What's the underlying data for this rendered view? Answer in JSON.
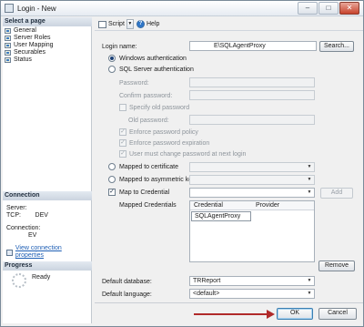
{
  "window": {
    "title": "Login - New"
  },
  "left": {
    "select_page_header": "Select a page",
    "pages": [
      "General",
      "Server Roles",
      "User Mapping",
      "Securables",
      "Status"
    ],
    "connection_header": "Connection",
    "server_label": "Server:",
    "server_value": "",
    "server_tcp": "TCP:",
    "server_tcp_value": "DEV",
    "connection_label": "Connection:",
    "connection_value": "EV",
    "view_connection_link": "View connection properties",
    "progress_header": "Progress",
    "progress_status": "Ready"
  },
  "toolbar": {
    "script_label": "Script",
    "help_label": "Help"
  },
  "form": {
    "login_name_label": "Login name:",
    "login_name_value": "E\\SQLAgentProxy",
    "search_button": "Search...",
    "windows_auth": "Windows authentication",
    "sql_auth": "SQL Server authentication",
    "password_label": "Password:",
    "confirm_password_label": "Confirm password:",
    "specify_old_password": "Specify old password",
    "old_password_label": "Old password:",
    "enforce_policy": "Enforce password policy",
    "enforce_expiration": "Enforce password expiration",
    "must_change": "User must change password at next login",
    "mapped_certificate": "Mapped to certificate",
    "mapped_asym_key": "Mapped to asymmetric key",
    "map_credential": "Map to Credential",
    "add_button": "Add",
    "mapped_credentials_label": "Mapped Credentials",
    "grid_col_credential": "Credential",
    "grid_col_provider": "Provider",
    "grid_row_credential": "SQLAgentProxy",
    "remove_button": "Remove",
    "default_database_label": "Default database:",
    "default_database_value": "TRReport",
    "default_language_label": "Default language:",
    "default_language_value": "<default>"
  },
  "footer": {
    "ok_button": "OK",
    "cancel_button": "Cancel"
  },
  "colors": {
    "annotation_arrow": "#b02a2a",
    "link": "#1f5fb5"
  }
}
